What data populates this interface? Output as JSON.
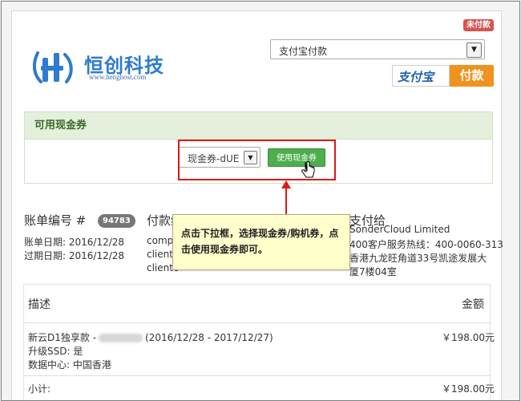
{
  "header": {
    "status_badge": "未付款",
    "logo_text": "恒创科技",
    "logo_url": "www.henghost.com",
    "payment_method_value": "支付宝付款",
    "alipay_label": "支付宝",
    "pay_button_label": "付款"
  },
  "voucher": {
    "panel_title": "可用现金券",
    "select_value": "现金券-dUE",
    "use_button_label": "使用现金券"
  },
  "tooltip": {
    "text": "点击下拉框，选择现金券/购机券，点击使用现金券即可。"
  },
  "invoice": {
    "number_label": "账单编号 #",
    "number_value": "94783",
    "bill_date": "账单日期: 2016/12/28",
    "due_date": "过期日期: 2016/12/28"
  },
  "pay_to": {
    "title": "付款给",
    "lines": [
      "compa",
      "clienta",
      "clientc"
    ]
  },
  "paid_to": {
    "title": "支付给",
    "lines": [
      "SonderCloud Limited",
      "400客户服务热线：400-0060-313",
      "香港九龙旺角道33号凯途发展大",
      "厦7楼04室"
    ]
  },
  "table": {
    "col_desc": "描述",
    "col_amount": "金额",
    "item": {
      "name_prefix": "新云D1独享款 -",
      "period": "(2016/12/28 - 2017/12/27)",
      "ssd": "升级SSD: 是",
      "datacenter": "数据中心: 中国香港",
      "amount": "￥198.00元"
    },
    "subtotal_label": "小计:",
    "subtotal_value": "￥198.00元"
  },
  "colors": {
    "accent_orange": "#f0921f",
    "voucher_green": "#4cae4c",
    "highlight_red": "#e01818",
    "brand_blue": "#2e7bd0"
  }
}
